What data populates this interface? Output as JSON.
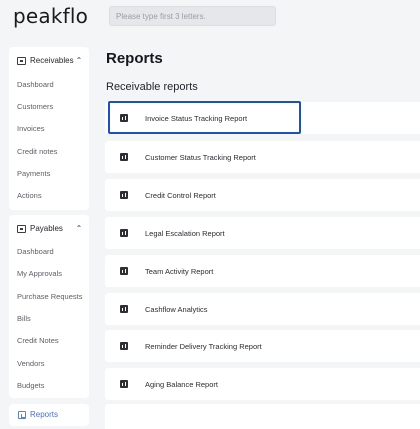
{
  "app": {
    "logo": "peakflo"
  },
  "search": {
    "placeholder": "Please type first 3 letters."
  },
  "sidebar": {
    "receivables": {
      "label": "Receivables",
      "items": [
        "Dashboard",
        "Customers",
        "Invoices",
        "Credit notes",
        "Payments",
        "Actions"
      ]
    },
    "payables": {
      "label": "Payables",
      "items": [
        "Dashboard",
        "My Approvals",
        "Purchase Requests",
        "Bills",
        "Credit Notes",
        "Vendors",
        "Budgets"
      ]
    },
    "reports": {
      "label": "Reports"
    }
  },
  "main": {
    "title": "Reports",
    "section": "Receivable reports",
    "reports": [
      "Invoice Status Tracking Report",
      "Customer Status Tracking Report",
      "Credit Control Report",
      "Legal Escalation Report",
      "Team Activity Report",
      "Cashflow Analytics",
      "Reminder Delivery Tracking Report",
      "Aging Balance Report"
    ]
  },
  "colors": {
    "accent": "#4a6fd1",
    "selected_border": "#1e4fbf",
    "background": "#f4f5f7"
  }
}
